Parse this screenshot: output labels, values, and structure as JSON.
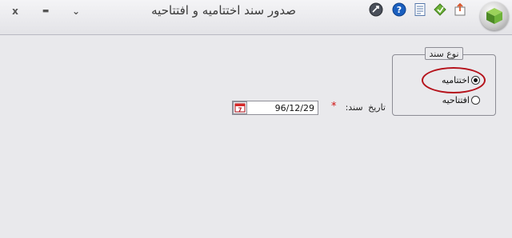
{
  "window": {
    "title": "صدور سند اختتامیه و افتتاحیه",
    "close_glyph": "x",
    "minimize_glyph": "▬",
    "restore_glyph": "⌄"
  },
  "toolbar": {
    "icons": [
      "back-icon",
      "help-icon",
      "document-icon",
      "shortcut-icon",
      "export-icon"
    ]
  },
  "doc_type_group": {
    "legend": "نوع سند",
    "options": [
      {
        "label": "اختتامیه",
        "checked": true
      },
      {
        "label": "افتتاحیه",
        "checked": false
      }
    ]
  },
  "date_field": {
    "label": "تاریخ سند:",
    "required_mark": "*",
    "value": "96/12/29"
  },
  "colors": {
    "highlight": "#b5121b",
    "required": "#d01010",
    "help_icon": "#1a5fbf"
  }
}
